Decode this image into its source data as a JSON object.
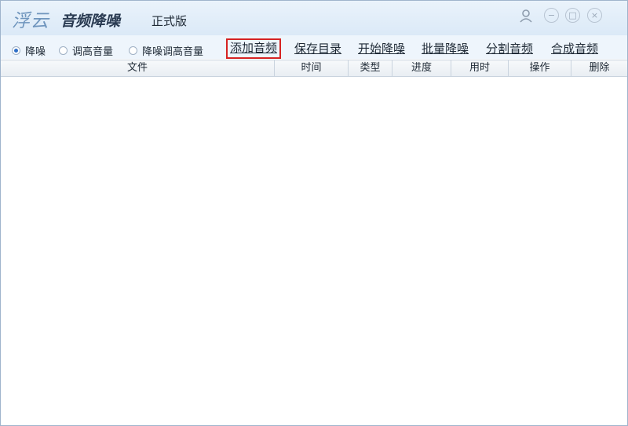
{
  "titlebar": {
    "brand": "浮云",
    "app_name": "音频降噪",
    "edition": "正式版",
    "icons": [
      "user-icon",
      "minimize-icon",
      "maximize-icon",
      "close-icon"
    ],
    "minimize_glyph": "−",
    "maximize_glyph": "□",
    "close_glyph": "×"
  },
  "toolbar": {
    "modes": [
      {
        "label": "降噪",
        "selected": true
      },
      {
        "label": "调高音量",
        "selected": false
      },
      {
        "label": "降噪调高音量",
        "selected": false
      }
    ],
    "actions": [
      "添加音频",
      "保存目录",
      "开始降噪",
      "批量降噪",
      "分割音频",
      "合成音频"
    ],
    "highlighted_action": "添加音频",
    "highlight_color": "#d62222"
  },
  "table": {
    "columns": [
      "文件",
      "时间",
      "类型",
      "进度",
      "用时",
      "操作",
      "删除"
    ],
    "rows": []
  },
  "colors": {
    "titlebar_bg": "#dbe9f7",
    "toolbar_bg": "#eef5fc",
    "radio_selected": "#2f6fc7"
  }
}
